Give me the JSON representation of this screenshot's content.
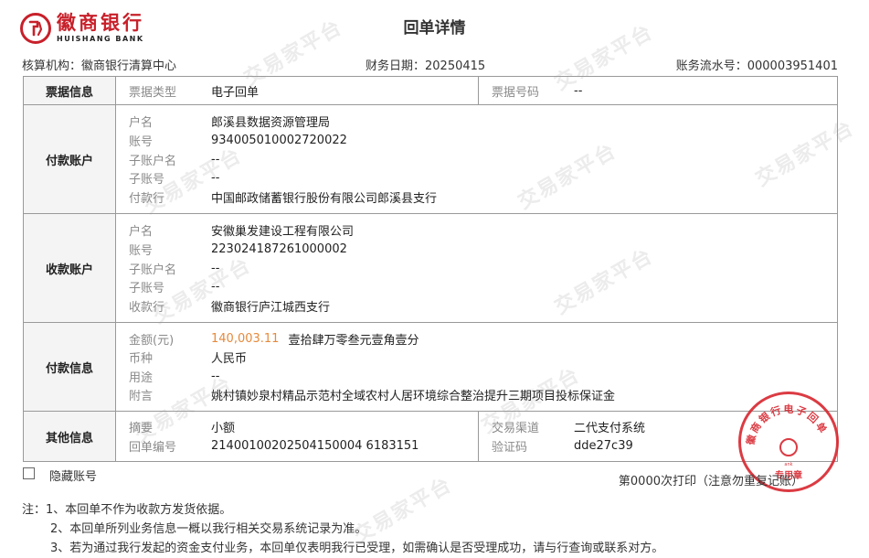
{
  "logo": {
    "cn": "徽商银行",
    "en": "HUISHANG BANK",
    "mark": "ank"
  },
  "title": "回单详情",
  "meta": {
    "org_label": "核算机构：",
    "org": "徽商银行清算中心",
    "date_label": "财务日期：",
    "date": "20250415",
    "serial_label": "账务流水号：",
    "serial": "000003951401"
  },
  "sections": {
    "bill": {
      "title": "票据信息",
      "type_label": "票据类型",
      "type_value": "电子回单",
      "no_label": "票据号码",
      "no_value": "--"
    },
    "payer": {
      "title": "付款账户",
      "rows": [
        {
          "label": "户名",
          "value": "郎溪县数据资源管理局"
        },
        {
          "label": "账号",
          "value": "934005010002720022"
        },
        {
          "label": "子账户名",
          "value": "--"
        },
        {
          "label": "子账号",
          "value": "--"
        },
        {
          "label": "付款行",
          "value": "中国邮政储蓄银行股份有限公司郎溪县支行"
        }
      ]
    },
    "payee": {
      "title": "收款账户",
      "rows": [
        {
          "label": "户名",
          "value": "安徽巢发建设工程有限公司"
        },
        {
          "label": "账号",
          "value": "223024187261000002"
        },
        {
          "label": "子账户名",
          "value": "--"
        },
        {
          "label": "子账号",
          "value": "--"
        },
        {
          "label": "收款行",
          "value": "徽商银行庐江城西支行"
        }
      ]
    },
    "payment": {
      "title": "付款信息",
      "amount_label": "金额(元)",
      "amount": "140,003.11",
      "amount_words": "壹拾肆万零叁元壹角壹分",
      "currency_label": "币种",
      "currency": "人民币",
      "usage_label": "用途",
      "usage": "--",
      "remark_label": "附言",
      "remark": "姚村镇妙泉村精品示范村全域农村人居环境综合整治提升三期项目投标保证金"
    },
    "other": {
      "title": "其他信息",
      "summary_label": "摘要",
      "summary": "小额",
      "receipt_no_label": "回单编号",
      "receipt_no": "21400100202504150004 6183151",
      "channel_label": "交易渠道",
      "channel": "二代支付系统",
      "code_label": "验证码",
      "code": "dde27c39"
    }
  },
  "hide_account_label": "隐藏账号",
  "print_info": "第0000次打印（注意勿重复记账）",
  "notes": [
    "注：1、本回单不作为收款方发货依据。",
    "2、本回单所列业务信息一概以我行相关交易系统记录为准。",
    "3、若为通过我行发起的资金支付业务，本回单仅表明我行已受理，如需确认是否受理成功，请与行查询或联系对方。"
  ],
  "seal": {
    "text": "徽商银行电子回单",
    "center": "专用章",
    "mark": "ank"
  },
  "watermark": "交易家平台",
  "colors": {
    "brand": "#c8202a",
    "amount": "#e68a3c",
    "label": "#8a8a8a",
    "seal": "#d8262f"
  }
}
